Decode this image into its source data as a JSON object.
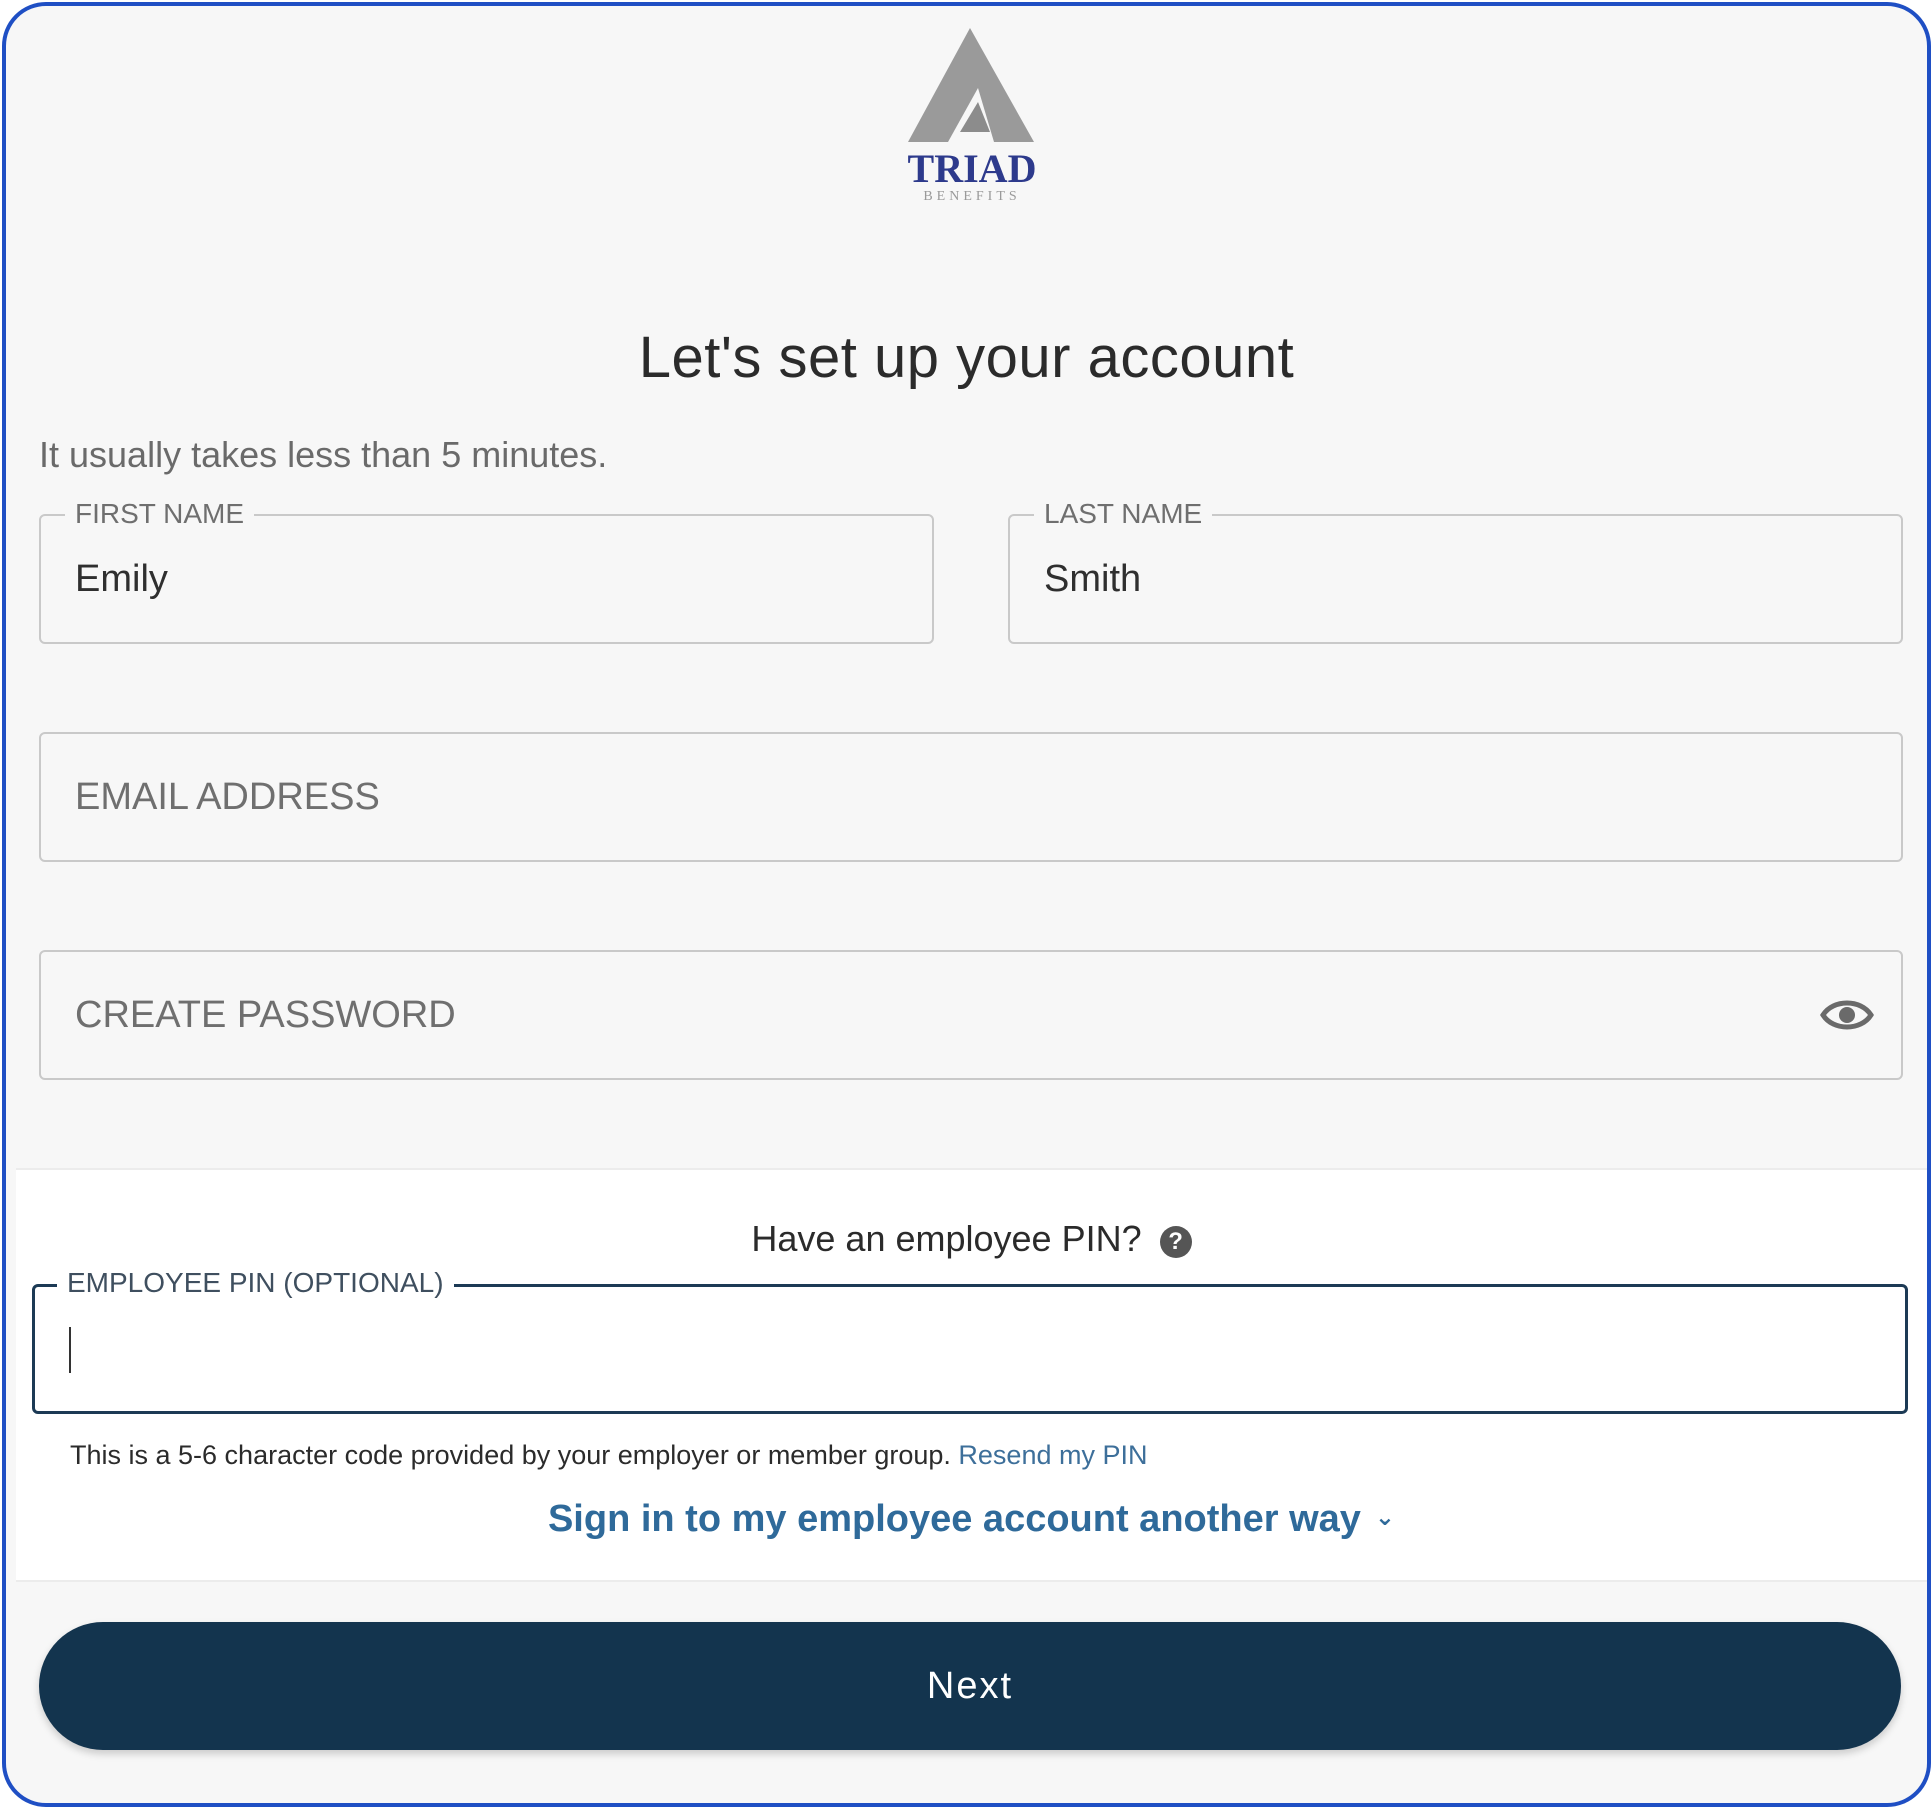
{
  "logo": {
    "name": "TRIAD",
    "tagline": "BENEFITS"
  },
  "header": {
    "title": "Let's set up your account",
    "subtitle": "It usually takes less than 5 minutes."
  },
  "form": {
    "first_name": {
      "label": "FIRST NAME",
      "value": "Emily"
    },
    "last_name": {
      "label": "LAST NAME",
      "value": "Smith"
    },
    "email": {
      "placeholder": "EMAIL ADDRESS",
      "value": ""
    },
    "password": {
      "placeholder": "CREATE PASSWORD",
      "value": "",
      "toggle_icon": "eye-icon"
    }
  },
  "pin_section": {
    "heading": "Have an employee PIN?",
    "help_icon": "question-circle-icon",
    "help_glyph": "?",
    "field_label": "EMPLOYEE PIN (OPTIONAL)",
    "value": "",
    "help_text": "This is a 5-6 character code provided by your employer or member group.",
    "resend_link": "Resend my PIN",
    "alt_signin": "Sign in to my employee account another way",
    "alt_signin_icon": "chevron-down-icon",
    "alt_signin_glyph": "⌄"
  },
  "actions": {
    "next_label": "Next"
  },
  "colors": {
    "frame_border": "#1f4fc4",
    "primary_button": "#13344e",
    "link": "#2f6a9a",
    "focused_border": "#1c3a55",
    "logo_text": "#2d3a8c",
    "logo_triangle": "#9a9a9a"
  }
}
